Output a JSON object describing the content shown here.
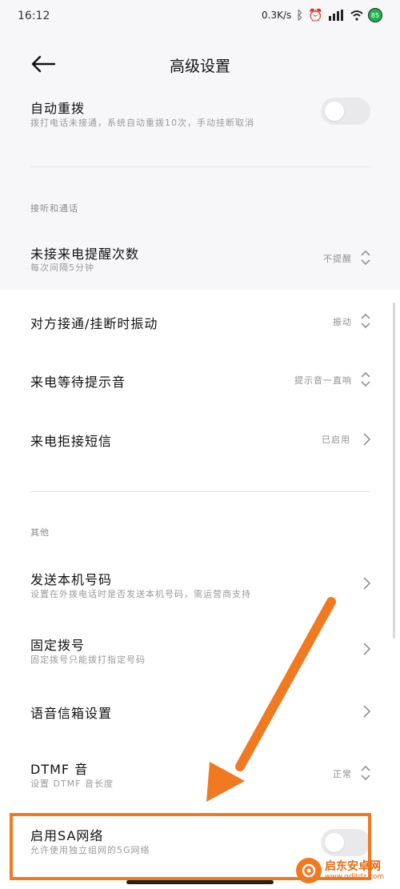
{
  "status_bar": {
    "time": "16:12",
    "net_speed": "0.3K/s",
    "battery": "85",
    "icons": [
      "bluetooth-icon",
      "alarm-icon",
      "signal-icon",
      "wifi-icon",
      "battery-icon"
    ]
  },
  "header": {
    "title": "高级设置",
    "back_icon": "arrow-left-icon"
  },
  "rows": {
    "auto_redial": {
      "title": "自动重拨",
      "subtitle": "拨打电话未接通，系统自动重拨10次，手动挂断取消",
      "toggle": "off"
    },
    "section_answer": "接听和通话",
    "missed_reminder": {
      "title": "未接来电提醒次数",
      "subtitle": "每次间隔5分钟",
      "value": "不提醒"
    },
    "connect_vibrate": {
      "title": "对方接通/挂断时振动",
      "value": "振动"
    },
    "call_waiting": {
      "title": "来电等待提示音",
      "value": "提示音一直响"
    },
    "reject_sms": {
      "title": "来电拒接短信",
      "value": "已启用"
    },
    "section_other": "其他",
    "send_number": {
      "title": "发送本机号码",
      "subtitle": "设置在外拨电话时是否发送本机号码，需运营商支持"
    },
    "fixed_dial": {
      "title": "固定拨号",
      "subtitle": "固定拨号只能拨打指定号码"
    },
    "voicemail": {
      "title": "语音信箱设置"
    },
    "dtmf": {
      "title": "DTMF 音",
      "subtitle": "设置 DTMF 音长度",
      "value": "正常"
    },
    "sa_network": {
      "title": "启用SA网络",
      "subtitle": "允许使用独立组网的5G网络",
      "toggle": "off"
    }
  },
  "watermark": {
    "main": "启东安卓网",
    "sub": "www.qdltdz.com"
  },
  "colors": {
    "accent": "#f07a22",
    "toggle_off": "#e9e9ec",
    "secondary_text": "#9a9a9a"
  }
}
